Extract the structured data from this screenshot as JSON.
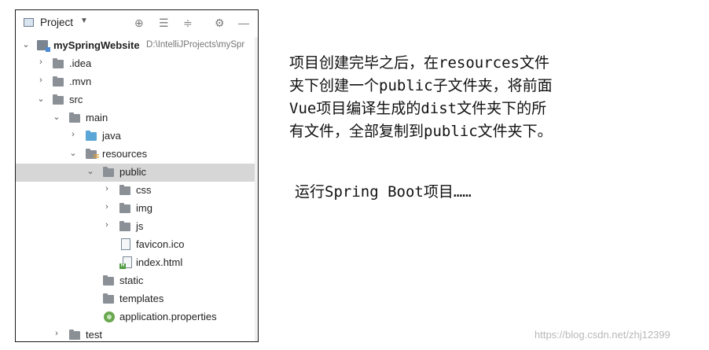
{
  "project_panel": {
    "title": "Project",
    "toolbar_icons": [
      "locate-icon",
      "expand-all-icon",
      "collapse-all-icon",
      "gear-icon",
      "minimize-icon"
    ],
    "tree": [
      {
        "label": "mySpringWebsite",
        "path": "D:\\IntelliJProjects\\mySpr",
        "icon": "module-folder-icon",
        "expanded": true,
        "bold": true
      },
      {
        "label": ".idea",
        "icon": "folder-icon",
        "expanded": false
      },
      {
        "label": ".mvn",
        "icon": "folder-icon",
        "expanded": false
      },
      {
        "label": "src",
        "icon": "folder-icon",
        "expanded": true
      },
      {
        "label": "main",
        "icon": "folder-icon",
        "expanded": true
      },
      {
        "label": "java",
        "icon": "source-folder-icon",
        "expanded": false
      },
      {
        "label": "resources",
        "icon": "resources-folder-icon",
        "expanded": true
      },
      {
        "label": "public",
        "icon": "folder-icon",
        "expanded": true,
        "selected": true
      },
      {
        "label": "css",
        "icon": "folder-icon",
        "expanded": false
      },
      {
        "label": "img",
        "icon": "folder-icon",
        "expanded": false
      },
      {
        "label": "js",
        "icon": "folder-icon",
        "expanded": false
      },
      {
        "label": "favicon.ico",
        "icon": "file-icon"
      },
      {
        "label": "index.html",
        "icon": "html-file-icon"
      },
      {
        "label": "static",
        "icon": "folder-icon"
      },
      {
        "label": "templates",
        "icon": "folder-icon"
      },
      {
        "label": "application.properties",
        "icon": "spring-properties-icon"
      },
      {
        "label": "test",
        "icon": "folder-icon",
        "expanded": false
      }
    ]
  },
  "notes": {
    "paragraph1_lines": [
      "项目创建完毕之后，在resources文件",
      "夹下创建一个public子文件夹，将前面",
      "Vue项目编译生成的dist文件夹下的所",
      "有文件，全部复制到public文件夹下。"
    ],
    "paragraph2": "运行Spring Boot项目……"
  },
  "watermark": "https://blog.csdn.net/zhj12399",
  "colors": {
    "selection": "#d6d6d6",
    "folder": "#8a9096",
    "source_folder": "#5aa6d6",
    "resources_marker": "#e3a23a"
  }
}
